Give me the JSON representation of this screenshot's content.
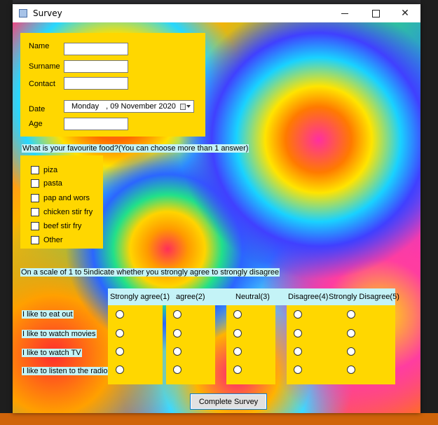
{
  "window": {
    "title": "Survey",
    "icon": "form-icon"
  },
  "personal": {
    "name_label": "Name",
    "surname_label": "Surname",
    "contact_label": "Contact",
    "date_label": "Date",
    "age_label": "Age",
    "name_value": "",
    "surname_value": "",
    "contact_value": "",
    "age_value": "",
    "date_day": "Monday",
    "date_rest": ", 09 November 2020"
  },
  "food": {
    "question": "What is your favourite food?(You can choose more than 1 answer)",
    "options": [
      "piza",
      "pasta",
      "pap and wors",
      "chicken stir fry",
      "beef stir fry",
      "Other"
    ]
  },
  "scale": {
    "instruction": "On a scale of 1 to 5indicate whether you strongly agree to strongly disagree",
    "columns": [
      "Strongly agree(1)",
      "agree(2)",
      "Neutral(3)",
      "Disagree(4)",
      "Strongly Disagree(5)"
    ],
    "statements": [
      "I like to eat out",
      "I like to watch movies",
      "I like to watch TV",
      "I like to listen to the radio"
    ]
  },
  "submit_label": "Complete Survey",
  "colors": {
    "panel": "#ffd700",
    "label_bg": "#c4f3f7",
    "button_border": "#0078d7"
  }
}
